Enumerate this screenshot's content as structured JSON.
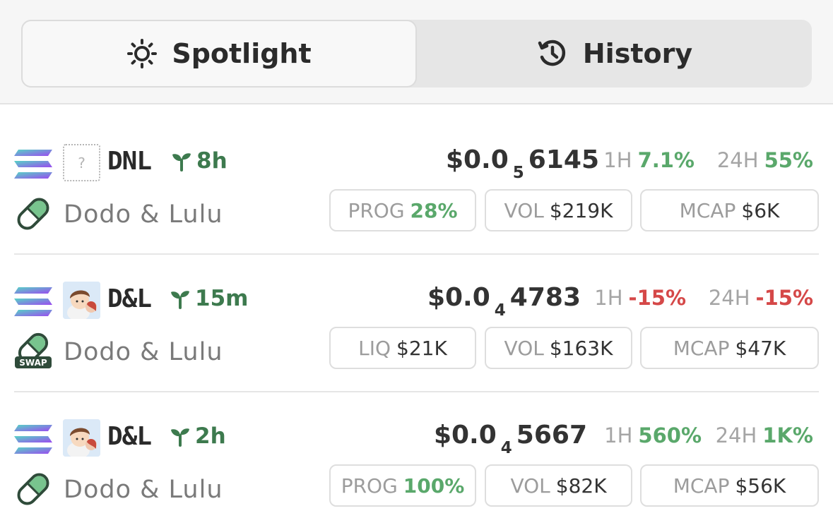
{
  "tabs": {
    "spotlight": {
      "label": "Spotlight",
      "icon": "sun-icon",
      "active": true
    },
    "history": {
      "label": "History",
      "icon": "history-icon",
      "active": false
    }
  },
  "colors": {
    "up": "#5aa86b",
    "down": "#d54848",
    "age": "#3d7a4e"
  },
  "rows": [
    {
      "ticker": "DNL",
      "thumbnail": "question-mark-placeholder",
      "thumb_text": "?",
      "age": "8h",
      "name": "Dodo & Lulu",
      "platform_icon": "pill-icon",
      "price_main": "$0.0",
      "price_zeros": "5",
      "price_digits": "6145",
      "h1_label": "1H",
      "h1_value": "7.1%",
      "h24_label": "24H",
      "h24_value": "55%",
      "pill1_label": "PROG",
      "pill1_value": "28%",
      "vol_label": "VOL",
      "vol_value": "$219K",
      "mcap_label": "MCAP",
      "mcap_value": "$6K"
    },
    {
      "ticker": "D&L",
      "thumbnail": "cartoon-avatar",
      "age": "15m",
      "name": "Dodo & Lulu",
      "platform_icon": "swap-pill-icon",
      "platform_badge": "SWAP",
      "price_main": "$0.0",
      "price_zeros": "4",
      "price_digits": "4783",
      "h1_label": "1H",
      "h1_value": "-15%",
      "h24_label": "24H",
      "h24_value": "-15%",
      "pill1_label": "LIQ",
      "pill1_value": "$21K",
      "vol_label": "VOL",
      "vol_value": "$163K",
      "mcap_label": "MCAP",
      "mcap_value": "$47K"
    },
    {
      "ticker": "D&L",
      "thumbnail": "cartoon-avatar",
      "age": "2h",
      "name": "Dodo & Lulu",
      "platform_icon": "pill-icon",
      "price_main": "$0.0",
      "price_zeros": "4",
      "price_digits": "5667",
      "h1_label": "1H",
      "h1_value": "560%",
      "h24_label": "24H",
      "h24_value": "1K%",
      "pill1_label": "PROG",
      "pill1_value": "100%",
      "vol_label": "VOL",
      "vol_value": "$82K",
      "mcap_label": "MCAP",
      "mcap_value": "$56K"
    }
  ]
}
